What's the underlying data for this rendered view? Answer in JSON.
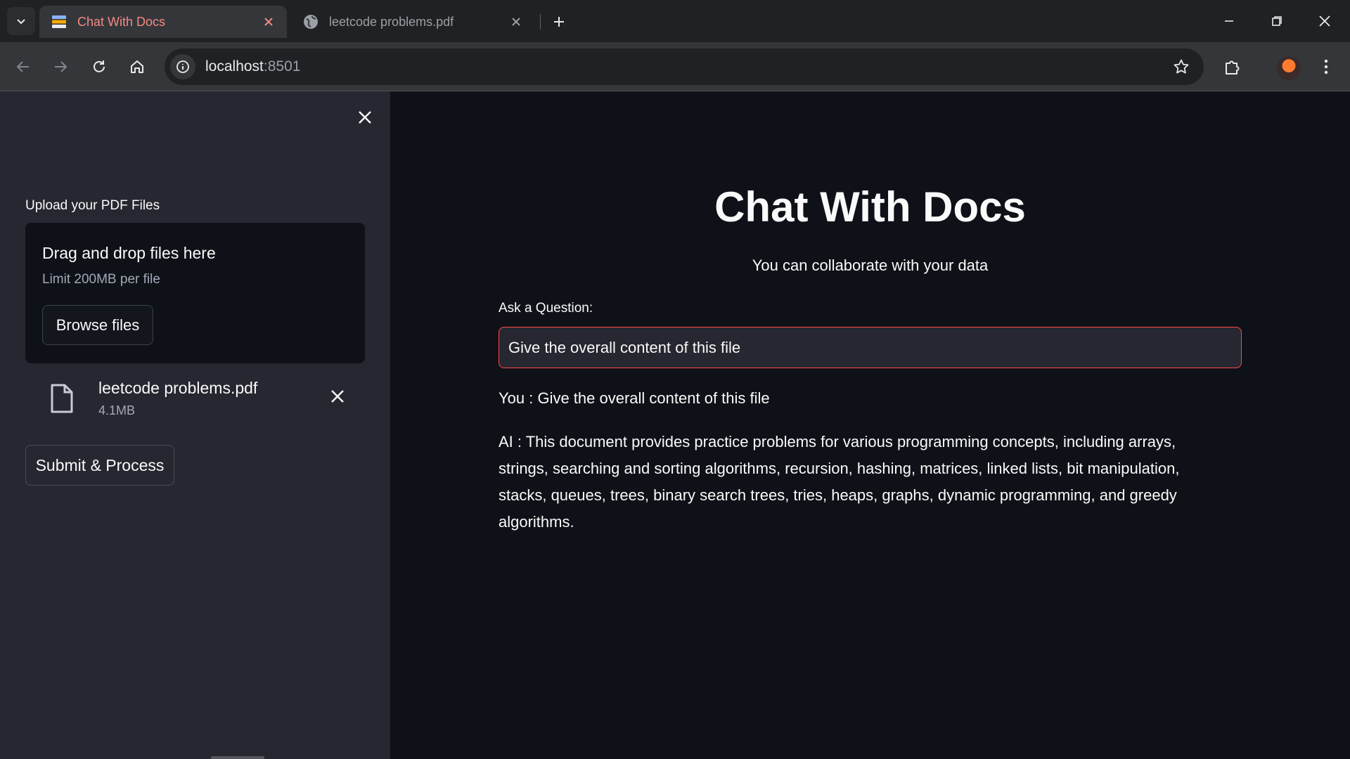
{
  "browser": {
    "tabs": [
      {
        "title": "Chat With Docs",
        "active": true,
        "icon": "streamlit-favicon"
      },
      {
        "title": "leetcode problems.pdf",
        "active": false,
        "icon": "globe-icon"
      }
    ],
    "url_host": "localhost",
    "url_port": ":8501",
    "accent_color": "#f28b82"
  },
  "sidebar": {
    "upload_label": "Upload your PDF Files",
    "dropzone": {
      "title": "Drag and drop files here",
      "limit": "Limit 200MB per file",
      "browse_label": "Browse files"
    },
    "file": {
      "name": "leetcode problems.pdf",
      "size": "4.1MB"
    },
    "submit_label": "Submit & Process"
  },
  "main": {
    "title": "Chat With Docs",
    "subtitle": "You can collaborate with your data",
    "ask_label": "Ask a Question:",
    "question_value": "Give the overall content of this file",
    "you_message": "You : Give the overall content of this file",
    "ai_message": "AI : This document provides practice problems for various programming concepts, including arrays, strings, searching and sorting algorithms, recursion, hashing, matrices, linked lists, bit manipulation, stacks, queues, trees, binary search trees, tries, heaps, graphs, dynamic programming, and greedy algorithms.",
    "input_border_color": "#ff4b4b"
  }
}
